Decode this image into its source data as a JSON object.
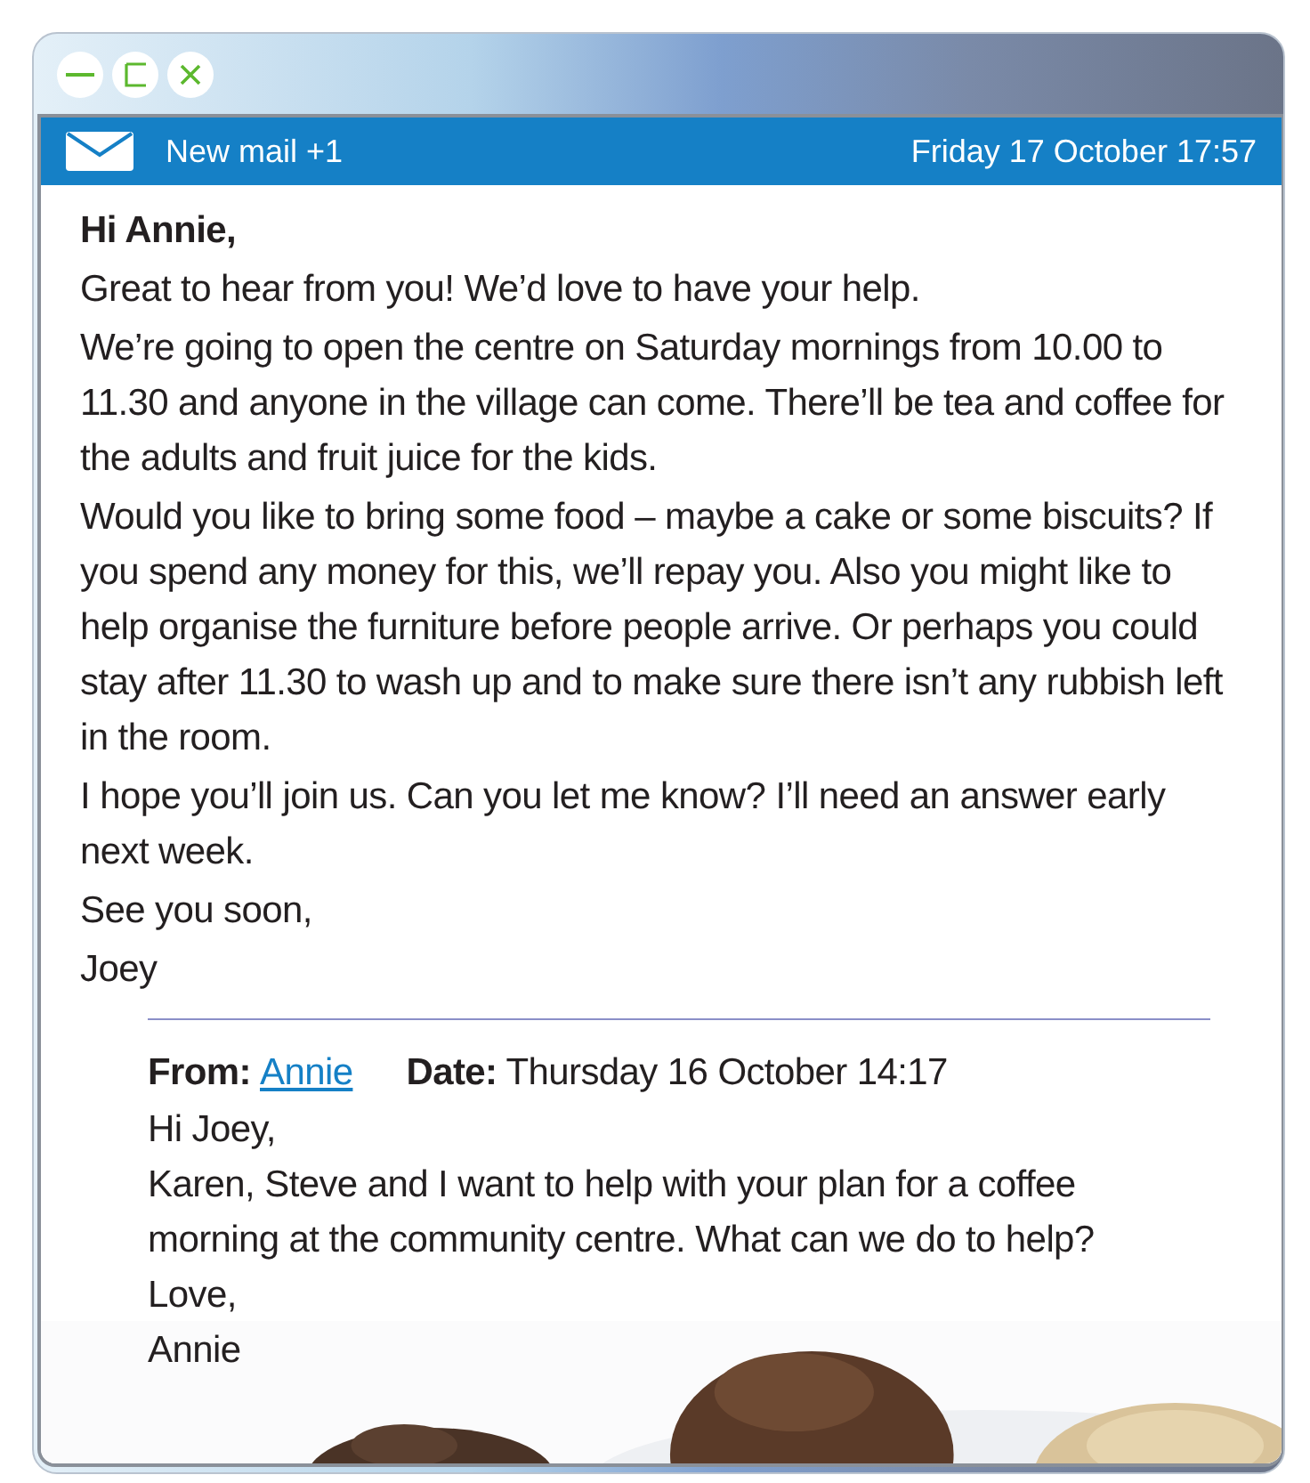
{
  "header": {
    "title": "New mail +1",
    "date": "Friday 17 October 17:57"
  },
  "message": {
    "greeting": "Hi Annie,",
    "paragraphs": [
      "Great to hear from you! We’d love to have your help.",
      "We’re going to open the centre on Saturday mornings from 10.00 to 11.30 and anyone in the village can come. There’ll be tea and coffee for the adults and fruit juice for the kids.",
      "Would you like to bring some food – maybe a cake or some biscuits? If you spend any money for this, we’ll repay you. Also you might like to help organise the furniture before people arrive. Or perhaps you could stay after 11.30 to wash up and to make sure there isn’t any rubbish left in the room.",
      "I hope you’ll join us. Can you let me know? I’ll need an answer early next week.",
      "See you soon,",
      "Joey"
    ]
  },
  "quoted": {
    "from_label": "From:",
    "from": "Annie",
    "date_label": "Date:",
    "date": "Thursday 16 October 14:17",
    "lines": [
      "Hi Joey,",
      "Karen, Steve and I want to help with your plan for a coffee morning at the community centre. What can we do to help?",
      "Love,",
      "Annie"
    ]
  }
}
